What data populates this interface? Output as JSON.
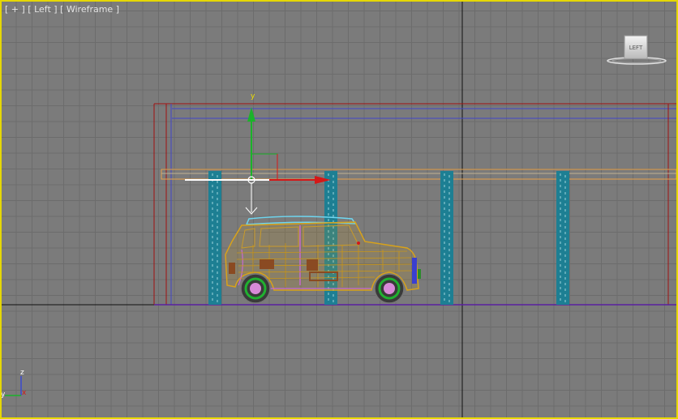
{
  "viewport": {
    "label": "[ + ] [ Left ] [ Wireframe ]",
    "label_parts": [
      "[ + ]",
      "[ Left ]",
      "[ Wireframe ]"
    ],
    "view_name": "Left",
    "shading_mode": "Wireframe"
  },
  "viewcube": {
    "face_label": "LEFT"
  },
  "gizmo": {
    "axis_y_label": "y"
  },
  "axis_tripod": {
    "z_label": "z",
    "y_label": "y",
    "x_label": "x"
  },
  "colors": {
    "viewport_border": "#e6d700",
    "background": "#7b7b7b",
    "grid": "#6c6c6c",
    "axis_y": "#1bb32a",
    "axis_x": "#d41818",
    "pillar": "#1d7f93",
    "car_wire": "#d8a21a",
    "frame_red": "#a01010",
    "frame_blue": "#4046c8"
  }
}
